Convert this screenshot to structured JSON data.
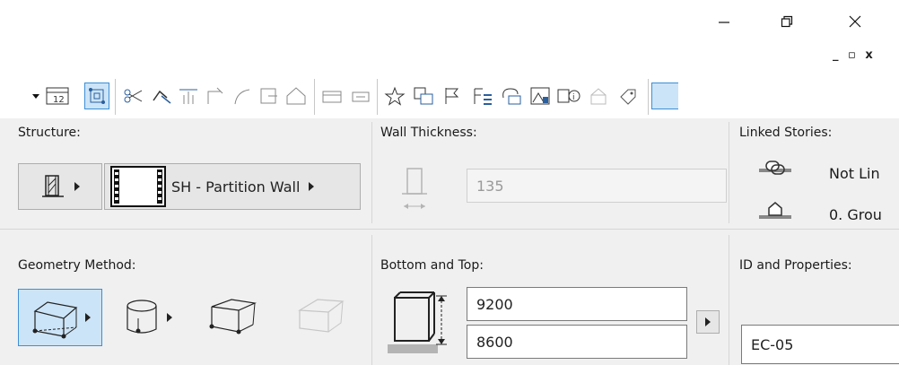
{
  "window": {
    "minimize_icon": "minimize-icon",
    "restore_icon": "restore-icon",
    "close_icon": "close-icon",
    "mdi_controls": "_ ▫ x"
  },
  "toolbar": {
    "icons": [
      "dropdown-arrow-icon",
      "scale-icon",
      "suspend-groups-icon",
      "split-icon",
      "adjust-icon",
      "elevate-icon",
      "intersect-icon",
      "fillet-icon",
      "offset-icon",
      "roof-icon",
      "distribute-icon",
      "align-icon",
      "favorites-icon",
      "group-icon",
      "flag-icon",
      "list-icon",
      "trace-icon",
      "layout-icon",
      "label-icon",
      "properties-icon",
      "tag-icon"
    ]
  },
  "structure": {
    "title": "Structure:",
    "profile_label": "SH - Partition Wall"
  },
  "wall_thickness": {
    "title": "Wall Thickness:",
    "value": "135"
  },
  "linked_stories": {
    "title": "Linked Stories:",
    "top_link": "Not Lin",
    "bottom_link": "0. Grou"
  },
  "geometry_method": {
    "title": "Geometry Method:"
  },
  "bottom_and_top": {
    "title": "Bottom and Top:",
    "top_value": "9200",
    "bottom_value": "8600"
  },
  "id_and_properties": {
    "title": "ID and Properties:",
    "id_value": "EC-05"
  },
  "colors": {
    "panel_bg": "#f0f0f0",
    "selected_bg": "#cce4f7",
    "selected_border": "#3c8fd6"
  }
}
